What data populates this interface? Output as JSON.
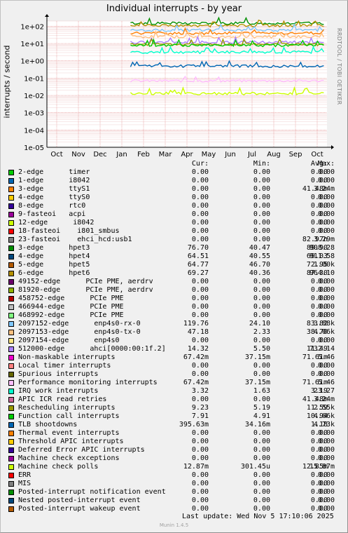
{
  "title": "Individual interrupts - by year",
  "side_text": "RRDTOOL / TOBI OETIKER",
  "footer_text": "Last update:  Wed Nov  5 17:10:06 2025",
  "munin_version": "Munin 1.4.5",
  "chart_data": {
    "type": "line",
    "title": "Individual interrupts - by year",
    "ylabel": "interrupts / second",
    "yscale": "log",
    "ylim": [
      1e-05,
      200
    ],
    "y_ticks": [
      "1e+02",
      "1e+01",
      "1e+00",
      "1e-01",
      "1e-02",
      "1e-03",
      "1e-04",
      "1e-05"
    ],
    "x_ticks": [
      "Oct",
      "Nov",
      "Dec",
      "Jan",
      "Feb",
      "Mar",
      "Apr",
      "May",
      "Jun",
      "Jul",
      "Aug",
      "Sep",
      "Oct"
    ],
    "grid": true,
    "legend_headers": [
      "Cur:",
      "Min:",
      "Avg:",
      "Max:"
    ],
    "series": [
      {
        "name": "2-edge      timer",
        "color": "#00cc00",
        "cur": "0.00",
        "min": "0.00",
        "avg": "0.00",
        "max": "0.00"
      },
      {
        "name": "1-edge      i8042",
        "color": "#0066b3",
        "cur": "0.00",
        "min": "0.00",
        "avg": "0.00",
        "max": "0.00"
      },
      {
        "name": "3-edge      ttyS1",
        "color": "#ff8000",
        "cur": "0.00",
        "min": "0.00",
        "avg": "41.48m",
        "max": "3.24m"
      },
      {
        "name": "4-edge      ttyS0",
        "color": "#ffcc00",
        "cur": "0.00",
        "min": "0.00",
        "avg": "0.00",
        "max": "0.00"
      },
      {
        "name": "8-edge      rtc0",
        "color": "#330099",
        "cur": "0.00",
        "min": "0.00",
        "avg": "0.00",
        "max": "0.00"
      },
      {
        "name": "9-fasteoi   acpi",
        "color": "#990099",
        "cur": "0.00",
        "min": "0.00",
        "avg": "0.00",
        "max": "0.00"
      },
      {
        "name": "12-edge      i8042",
        "color": "#ccff00",
        "cur": "0.00",
        "min": "0.00",
        "avg": "0.00",
        "max": "0.00"
      },
      {
        "name": "18-fasteoi    i801_smbus",
        "color": "#ff0000",
        "cur": "0.00",
        "min": "0.00",
        "avg": "0.00",
        "max": "0.00"
      },
      {
        "name": "23-fasteoi    ehci_hcd:usb1",
        "color": "#808080",
        "cur": "0.00",
        "min": "0.00",
        "avg": "82.97n",
        "max": "3.29m"
      },
      {
        "name": "3-edge      hpet3",
        "color": "#008f00",
        "cur": "76.70",
        "min": "40.47",
        "avg": "89.90",
        "max": "908.28"
      },
      {
        "name": "4-edge      hpet4",
        "color": "#00487d",
        "cur": "64.51",
        "min": "40.55",
        "avg": "69.03",
        "max": "911.58"
      },
      {
        "name": "5-edge      hpet5",
        "color": "#b35a00",
        "cur": "64.77",
        "min": "46.70",
        "avg": "72.95",
        "max": "1.00k"
      },
      {
        "name": "6-edge      hpet6",
        "color": "#b38f00",
        "cur": "69.27",
        "min": "40.36",
        "avg": "87.30",
        "max": "964.10"
      },
      {
        "name": "49152-edge      PCIe PME, aerdrv",
        "color": "#6b006b",
        "cur": "0.00",
        "min": "0.00",
        "avg": "0.00",
        "max": "0.00"
      },
      {
        "name": "81920-edge      PCIe PME, aerdrv",
        "color": "#8fb300",
        "cur": "0.00",
        "min": "0.00",
        "avg": "0.00",
        "max": "0.00"
      },
      {
        "name": "458752-edge      PCIe PME",
        "color": "#b30000",
        "cur": "0.00",
        "min": "0.00",
        "avg": "0.00",
        "max": "0.00"
      },
      {
        "name": "466944-edge      PCIe PME",
        "color": "#bebebe",
        "cur": "0.00",
        "min": "0.00",
        "avg": "0.00",
        "max": "0.00"
      },
      {
        "name": "468992-edge      PCIe PME",
        "color": "#80ff80",
        "cur": "0.00",
        "min": "0.00",
        "avg": "0.00",
        "max": "0.00"
      },
      {
        "name": "2097152-edge      enp4s0-rx-0",
        "color": "#80c9ff",
        "cur": "119.76",
        "min": "24.10",
        "avg": "83.82",
        "max": "3.88k"
      },
      {
        "name": "2097153-edge      enp4s0-tx-0",
        "color": "#ffc080",
        "cur": "47.18",
        "min": "2.33",
        "avg": "38.70",
        "max": "4.06k"
      },
      {
        "name": "2097154-edge      enp4s0",
        "color": "#ffe680",
        "cur": "0.00",
        "min": "0.00",
        "avg": "0.00",
        "max": "0.00"
      },
      {
        "name": "512000-edge      ahci[0000:00:1f.2]",
        "color": "#aa80ff",
        "cur": "14.32",
        "min": "5.50",
        "avg": "11.49",
        "max": "732.14"
      },
      {
        "name": "Non-maskable interrupts",
        "color": "#ee00cc",
        "cur": "67.42m",
        "min": "37.15m",
        "avg": "71.61m",
        "max": "5.46"
      },
      {
        "name": "Local timer interrupts",
        "color": "#ff8080",
        "cur": "0.00",
        "min": "0.00",
        "avg": "0.00",
        "max": "0.00"
      },
      {
        "name": "Spurious interrupts",
        "color": "#666600",
        "cur": "0.00",
        "min": "0.00",
        "avg": "0.00",
        "max": "0.00"
      },
      {
        "name": "Performance monitoring interrupts",
        "color": "#ffbfff",
        "cur": "67.42m",
        "min": "37.15m",
        "avg": "71.61m",
        "max": "5.46"
      },
      {
        "name": "IRQ work interrupts",
        "color": "#00ffcc",
        "cur": "3.32",
        "min": "1.63",
        "avg": "3.19",
        "max": "23.27"
      },
      {
        "name": "APIC ICR read retries",
        "color": "#cc6699",
        "cur": "0.00",
        "min": "0.00",
        "avg": "41.48m",
        "max": "3.24m"
      },
      {
        "name": "Rescheduling interrupts",
        "color": "#999900",
        "cur": "9.23",
        "min": "5.19",
        "avg": "11.59",
        "max": "2.55k"
      },
      {
        "name": "Function call interrupts",
        "color": "#00cc00",
        "cur": "7.91",
        "min": "4.91",
        "avg": "10.94",
        "max": "4.66k"
      },
      {
        "name": "TLB shootdowns",
        "color": "#0066b3",
        "cur": "395.63m",
        "min": "34.16m",
        "avg": "1.18",
        "max": "4.73k"
      },
      {
        "name": "Thermal event interrupts",
        "color": "#ff8000",
        "cur": "0.00",
        "min": "0.00",
        "avg": "0.00",
        "max": "0.00"
      },
      {
        "name": "Threshold APIC interrupts",
        "color": "#ffcc00",
        "cur": "0.00",
        "min": "0.00",
        "avg": "0.00",
        "max": "0.00"
      },
      {
        "name": "Deferred Error APIC interrupts",
        "color": "#330099",
        "cur": "0.00",
        "min": "0.00",
        "avg": "0.00",
        "max": "0.00"
      },
      {
        "name": "Machine check exceptions",
        "color": "#990099",
        "cur": "0.00",
        "min": "0.00",
        "avg": "0.00",
        "max": "0.00"
      },
      {
        "name": "Machine check polls",
        "color": "#ccff00",
        "cur": "12.87m",
        "min": "301.45u",
        "avg": "12.85m",
        "max": "15.87m"
      },
      {
        "name": "ERR",
        "color": "#ff0000",
        "cur": "0.00",
        "min": "0.00",
        "avg": "0.00",
        "max": "0.00"
      },
      {
        "name": "MIS",
        "color": "#808080",
        "cur": "0.00",
        "min": "0.00",
        "avg": "0.00",
        "max": "0.00"
      },
      {
        "name": "Posted-interrupt notification event",
        "color": "#008f00",
        "cur": "0.00",
        "min": "0.00",
        "avg": "0.00",
        "max": "0.00"
      },
      {
        "name": "Nested posted-interrupt event",
        "color": "#00487d",
        "cur": "0.00",
        "min": "0.00",
        "avg": "0.00",
        "max": "0.00"
      },
      {
        "name": "Posted-interrupt wakeup event",
        "color": "#b35a00",
        "cur": "0.00",
        "min": "0.00",
        "avg": "0.00",
        "max": "0.00"
      }
    ],
    "plotted_levels": [
      {
        "color": "#008f00",
        "value": 150
      },
      {
        "color": "#b38f00",
        "value": 110
      },
      {
        "color": "#80c9ff",
        "value": 60
      },
      {
        "color": "#ff8000",
        "value": 40
      },
      {
        "color": "#ffc080",
        "value": 25
      },
      {
        "color": "#aa80ff",
        "value": 12
      },
      {
        "color": "#999900",
        "value": 9
      },
      {
        "color": "#00cc00",
        "value": 8
      },
      {
        "color": "#00ffcc",
        "value": 3.2
      },
      {
        "color": "#0066b3",
        "value": 0.5
      },
      {
        "color": "#ffbfff",
        "value": 0.07
      },
      {
        "color": "#ccff00",
        "value": 0.013
      }
    ]
  }
}
